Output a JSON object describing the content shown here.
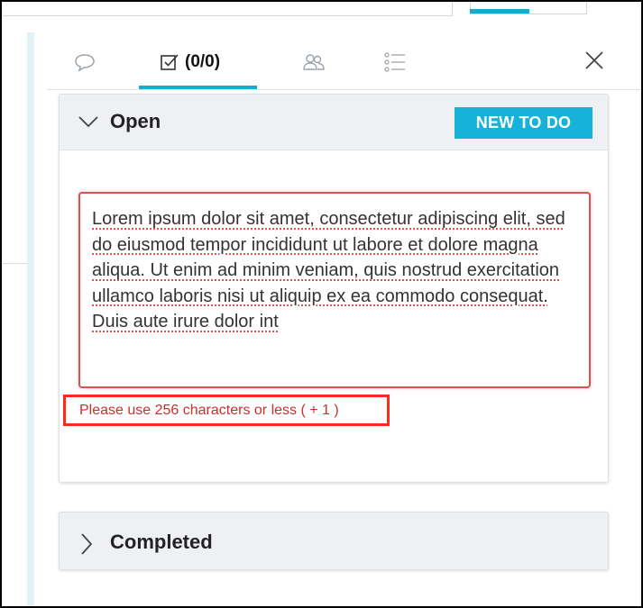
{
  "tabs": [
    {
      "icon": "comment-icon",
      "label": ""
    },
    {
      "icon": "checkbox-icon",
      "label": "(0/0)"
    },
    {
      "icon": "people-icon",
      "label": ""
    },
    {
      "icon": "list-icon",
      "label": ""
    }
  ],
  "open_section": {
    "title": "Open",
    "new_button_label": "NEW TO DO",
    "todo_text": "Lorem ipsum dolor sit amet, consectetur adipiscing elit, sed do eiusmod tempor incididunt ut labore et dolore magna aliqua. Ut enim ad minim veniam, quis nostrud exercitation ullamco laboris nisi ut aliquip ex ea commodo consequat. Duis aute irure dolor int",
    "error_message": "Please use 256 characters or less ( + 1 )"
  },
  "completed_section": {
    "title": "Completed"
  },
  "colors": {
    "accent": "#17b2d8",
    "error": "#d9534f",
    "highlight_box": "#ff2a1a"
  }
}
